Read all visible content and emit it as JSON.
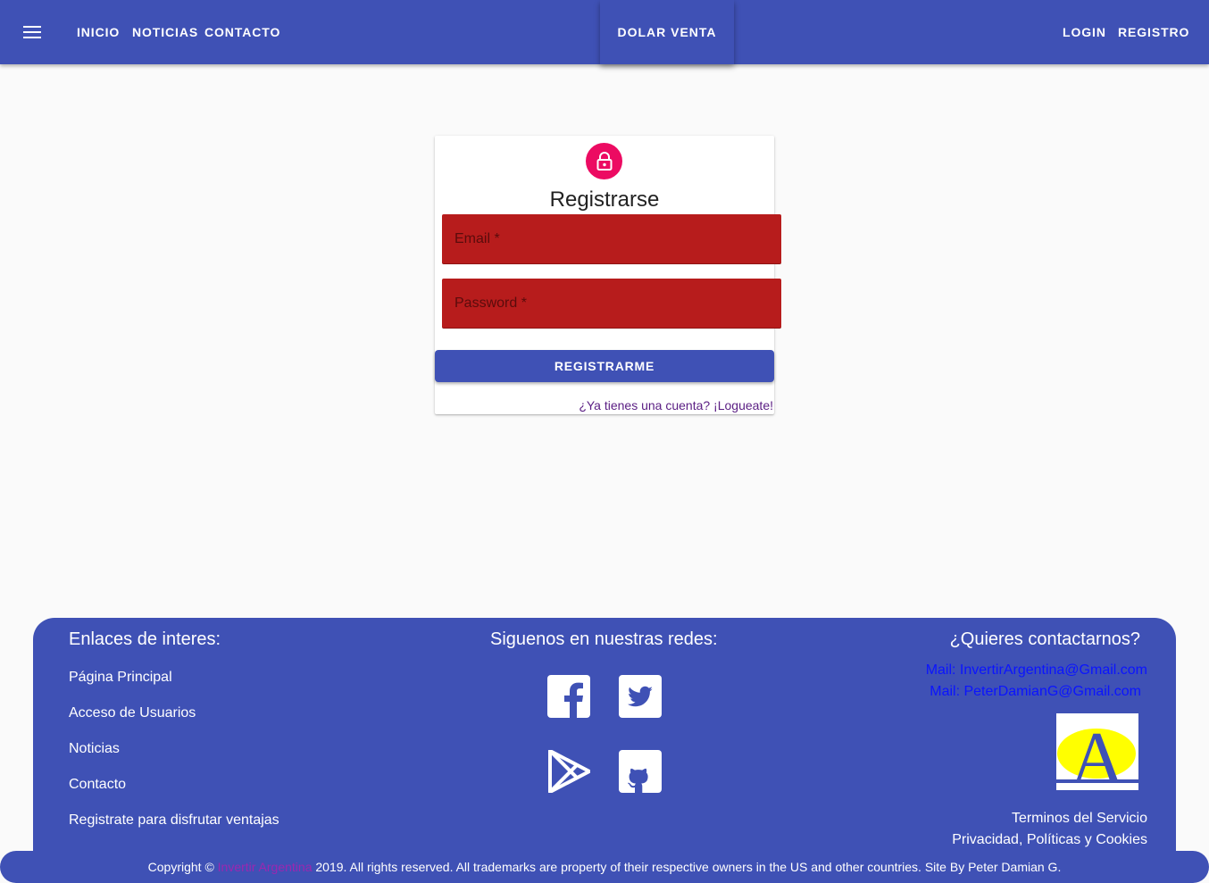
{
  "appbar": {
    "nav": [
      "INICIO",
      "NOTICIAS",
      "CONTACTO"
    ],
    "dolar": "DOLAR VENTA",
    "login": "LOGIN",
    "registro": "REGISTRO"
  },
  "card": {
    "title": "Registrarse",
    "email_label": "Email *",
    "password_label": "Password *",
    "submit": "REGISTRARME",
    "login_link": "¿Ya tienes una cuenta? ¡Logueate!"
  },
  "footer": {
    "links_title": "Enlaces de interes:",
    "links": [
      "Página Principal",
      "Acceso de Usuarios",
      "Noticias",
      "Contacto",
      "Registrate para disfrutar ventajas"
    ],
    "social_title": "Siguenos en nuestras redes:",
    "social": [
      "facebook-icon",
      "twitter-icon",
      "google-play-icon",
      "github-icon"
    ],
    "contact_title": "¿Quieres contactarnos?",
    "mails": [
      "Mail: InvertirArgentina@Gmail.com",
      "Mail: PeterDamianG@Gmail.com"
    ],
    "logo_letter": "A",
    "terms": "Terminos del Servicio",
    "privacy": "Privacidad, Políticas y Cookies"
  },
  "copyright": {
    "prefix": "Copyright ©",
    "brand": "Invertir Argentina",
    "suffix": "2019. All rights reserved. All trademarks are property of their respective owners in the US and other countries. Site By Peter Damian G."
  },
  "colors": {
    "primary": "#3f51b5",
    "error": "#b71c1c",
    "accent": "#ec0b62",
    "mail_link": "#0b14ff",
    "brand_link": "#9c27b0"
  }
}
